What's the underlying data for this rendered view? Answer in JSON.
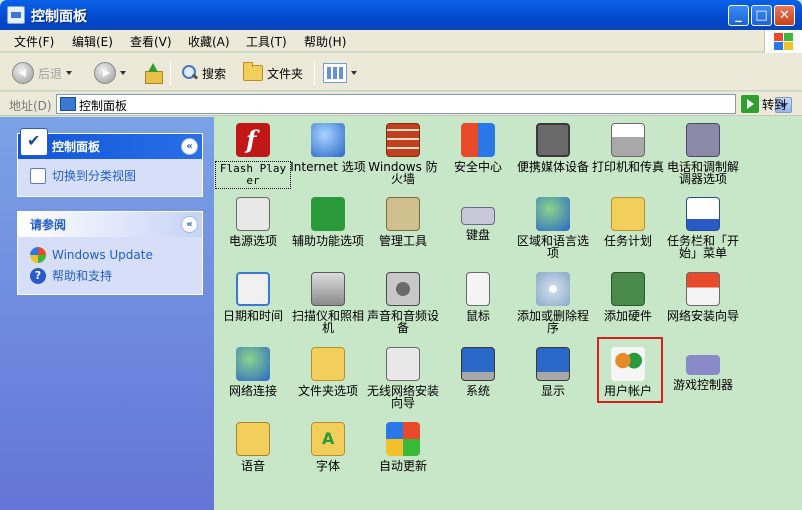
{
  "window": {
    "title": "控制面板",
    "buttons": {
      "minimize": "_",
      "maximize": "□",
      "close": "✕"
    }
  },
  "menu": [
    "文件(F)",
    "编辑(E)",
    "查看(V)",
    "收藏(A)",
    "工具(T)",
    "帮助(H)"
  ],
  "toolbar": {
    "back": "后退",
    "search": "搜索",
    "folders": "文件夹"
  },
  "address": {
    "label": "地址(D)",
    "value": "控制面板",
    "go": "转到"
  },
  "sidebar": {
    "panel1": {
      "title": "控制面板",
      "link": "切换到分类视图"
    },
    "panel2": {
      "title": "请参阅",
      "links": [
        "Windows Update",
        "帮助和支持"
      ]
    },
    "collapse_symbol": "«"
  },
  "items": [
    {
      "name": "flash-player",
      "label": "Flash Player",
      "icon": "flash-icon"
    },
    {
      "name": "internet-options",
      "label": "Internet 选项",
      "icon": "internet-options-icon"
    },
    {
      "name": "windows-firewall",
      "label": "Windows 防火墙",
      "icon": "firewall-icon"
    },
    {
      "name": "security-center",
      "label": "安全中心",
      "icon": "shield-icon"
    },
    {
      "name": "portable-media",
      "label": "便携媒体设备",
      "icon": "media-device-icon"
    },
    {
      "name": "printers-faxes",
      "label": "打印机和传真",
      "icon": "printer-icon"
    },
    {
      "name": "phone-modem",
      "label": "电话和调制解调器选项",
      "icon": "phone-icon"
    },
    {
      "name": "power-options",
      "label": "电源选项",
      "icon": "power-icon"
    },
    {
      "name": "accessibility",
      "label": "辅助功能选项",
      "icon": "accessibility-icon"
    },
    {
      "name": "admin-tools",
      "label": "管理工具",
      "icon": "tools-icon"
    },
    {
      "name": "keyboard",
      "label": "键盘",
      "icon": "keyboard-icon"
    },
    {
      "name": "regional-language",
      "label": "区域和语言选项",
      "icon": "globe-icon"
    },
    {
      "name": "scheduled-tasks",
      "label": "任务计划",
      "icon": "folder-clock-icon"
    },
    {
      "name": "taskbar-start",
      "label": "任务栏和「开始」菜单",
      "icon": "taskbar-icon"
    },
    {
      "name": "date-time",
      "label": "日期和时间",
      "icon": "clock-icon"
    },
    {
      "name": "scanners-cameras",
      "label": "扫描仪和照相机",
      "icon": "scanner-icon"
    },
    {
      "name": "sounds-audio",
      "label": "声音和音频设备",
      "icon": "speaker-icon"
    },
    {
      "name": "mouse",
      "label": "鼠标",
      "icon": "mouse-icon"
    },
    {
      "name": "add-remove-programs",
      "label": "添加或删除程序",
      "icon": "cd-icon"
    },
    {
      "name": "add-hardware",
      "label": "添加硬件",
      "icon": "hardware-icon"
    },
    {
      "name": "network-setup",
      "label": "网络安装向导",
      "icon": "network-house-icon"
    },
    {
      "name": "network-connections",
      "label": "网络连接",
      "icon": "network-globe-icon"
    },
    {
      "name": "folder-options",
      "label": "文件夹选项",
      "icon": "folder-icon"
    },
    {
      "name": "wireless-setup",
      "label": "无线网络安装向导",
      "icon": "wireless-icon"
    },
    {
      "name": "system",
      "label": "系统",
      "icon": "computer-icon"
    },
    {
      "name": "display",
      "label": "显示",
      "icon": "monitor-icon"
    },
    {
      "name": "user-accounts",
      "label": "用户帐户",
      "icon": "users-icon"
    },
    {
      "name": "game-controllers",
      "label": "游戏控制器",
      "icon": "gamepad-icon"
    },
    {
      "name": "speech",
      "label": "语音",
      "icon": "speech-icon"
    },
    {
      "name": "fonts",
      "label": "字体",
      "icon": "font-folder-icon"
    },
    {
      "name": "automatic-updates",
      "label": "自动更新",
      "icon": "windows-update-icon"
    }
  ],
  "colors": {
    "titlebar": "#0550d6",
    "content_bg": "#c8e6c8",
    "sidebar_bg": "#6d8ee0",
    "link": "#215dc6",
    "highlight": "#d42020"
  }
}
